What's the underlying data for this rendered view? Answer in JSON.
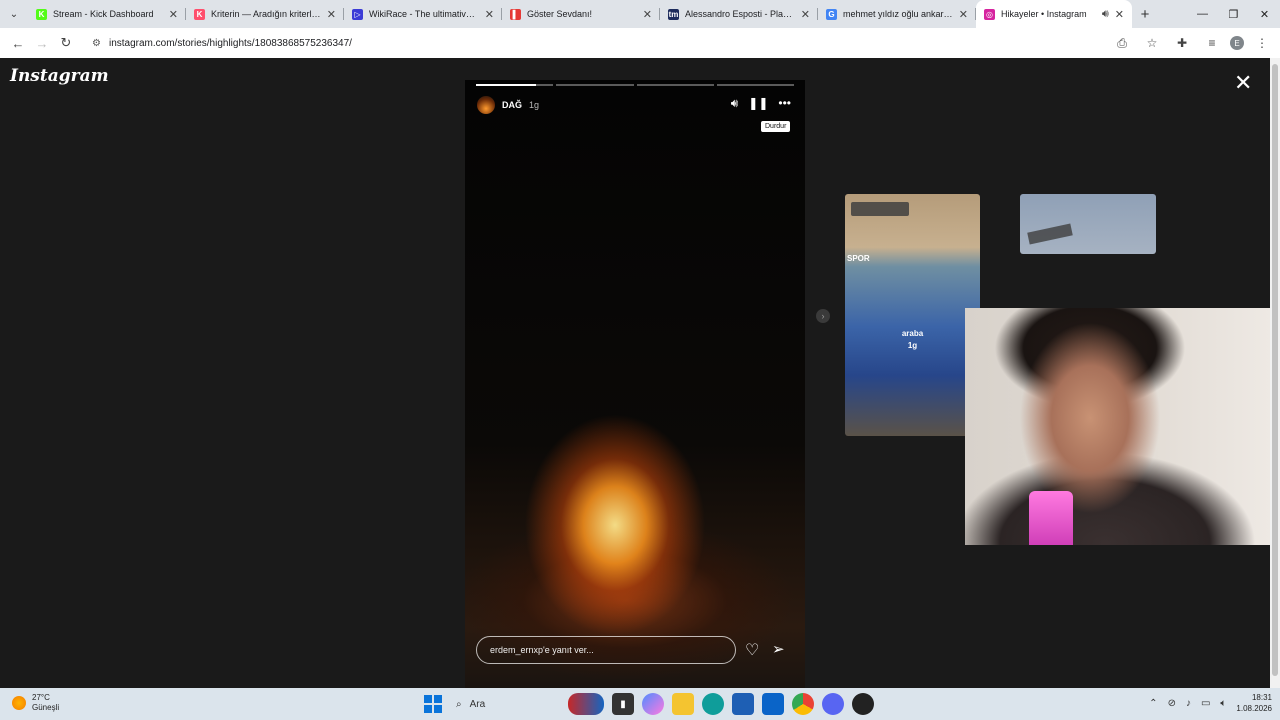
{
  "browser": {
    "tabs": [
      {
        "title": "Stream - Kick Dashboard",
        "color": "#53fc18",
        "glyph": "K"
      },
      {
        "title": "Kriterin — Aradığın kriterlere k",
        "color": "#ff4f6d",
        "glyph": "K"
      },
      {
        "title": "WikiRace - The ultimative Wiki",
        "color": "#3b3bd6",
        "glyph": "▷"
      },
      {
        "title": "Göster Sevdanı!",
        "color": "#e53935",
        "glyph": "▌"
      },
      {
        "title": "Alessandro Esposti - Player pro",
        "color": "#1d2b5c",
        "glyph": "tm"
      },
      {
        "title": "mehmet yıldız oğlu ankaragücü",
        "color": "#4285f4",
        "glyph": "G"
      },
      {
        "title": "Hikayeler • Instagram",
        "color": "#d6249f",
        "glyph": "◎",
        "active": true
      }
    ],
    "new_tab": "+",
    "window_controls": {
      "minimize": "—",
      "maximize": "❐",
      "close": "✕"
    },
    "url": "instagram.com/stories/highlights/18083868575236347/",
    "profile_initial": "E"
  },
  "instagram": {
    "logo": "Instagram",
    "close": "✕",
    "story": {
      "username": "DAĞ",
      "age": "1g",
      "tooltip": "Durdur",
      "reply_placeholder": "erdem_ernxp'e yanıt ver..."
    },
    "preview": {
      "spor": "SPOR",
      "name": "araba",
      "age": "1g"
    }
  },
  "taskbar": {
    "temp": "27°C",
    "weather": "Güneşli",
    "search": "Ara",
    "time": "18:31",
    "date": "1.08.2026"
  }
}
